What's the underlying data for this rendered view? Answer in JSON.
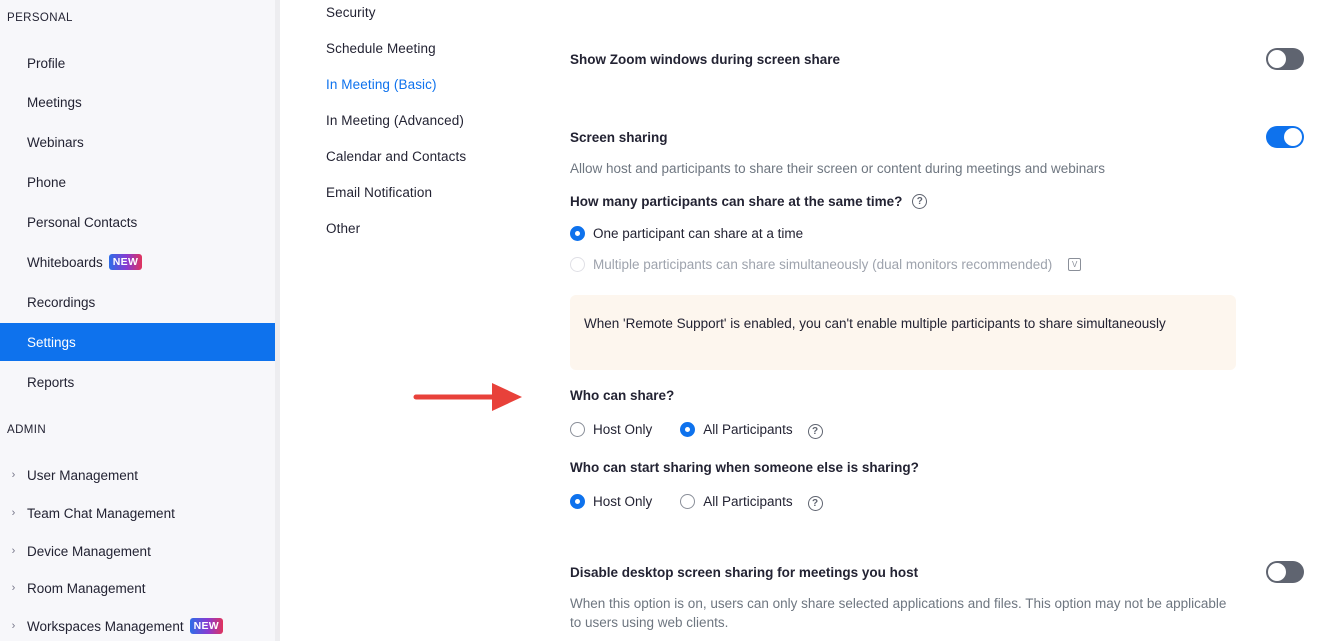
{
  "sidebar": {
    "personal_heading": "PERSONAL",
    "personal_items": [
      {
        "label": "Profile"
      },
      {
        "label": "Meetings"
      },
      {
        "label": "Webinars"
      },
      {
        "label": "Phone"
      },
      {
        "label": "Personal Contacts"
      },
      {
        "label": "Whiteboards",
        "badge": "NEW"
      },
      {
        "label": "Recordings"
      },
      {
        "label": "Settings",
        "active": true
      },
      {
        "label": "Reports"
      }
    ],
    "admin_heading": "ADMIN",
    "admin_items": [
      {
        "label": "User Management"
      },
      {
        "label": "Team Chat Management"
      },
      {
        "label": "Device Management"
      },
      {
        "label": "Room Management"
      },
      {
        "label": "Workspaces Management",
        "badge": "NEW"
      }
    ]
  },
  "tabs": [
    {
      "label": "Security"
    },
    {
      "label": "Schedule Meeting"
    },
    {
      "label": "In Meeting (Basic)",
      "active": true
    },
    {
      "label": "In Meeting (Advanced)"
    },
    {
      "label": "Calendar and Contacts"
    },
    {
      "label": "Email Notification"
    },
    {
      "label": "Other"
    }
  ],
  "settings": {
    "show_zoom_windows": {
      "label": "Show Zoom windows during screen share",
      "enabled": false
    },
    "screen_sharing": {
      "label": "Screen sharing",
      "enabled": true,
      "description": "Allow host and participants to share their screen or content during meetings and webinars",
      "how_many_question": "How many participants can share at the same time?",
      "option_one": "One participant can share at a time",
      "option_multiple": "Multiple participants can share simultaneously (dual monitors recommended)",
      "notice": "When 'Remote Support' is enabled, you can't enable multiple participants to share simultaneously",
      "who_can_share_question": "Who can share?",
      "who_can_share_host": "Host Only",
      "who_can_share_all": "All Participants",
      "who_can_start_question": "Who can start sharing when someone else is sharing?",
      "who_can_start_host": "Host Only",
      "who_can_start_all": "All Participants"
    },
    "disable_desktop_sharing": {
      "label": "Disable desktop screen sharing for meetings you host",
      "enabled": false,
      "description": "When this option is on, users can only share selected applications and files. This option may not be applicable to users using web clients."
    }
  },
  "icons": {
    "help": "?",
    "lock": "V",
    "chevron": "›"
  },
  "colors": {
    "accent": "#0e72ed",
    "annotation_arrow": "#e8413a"
  }
}
